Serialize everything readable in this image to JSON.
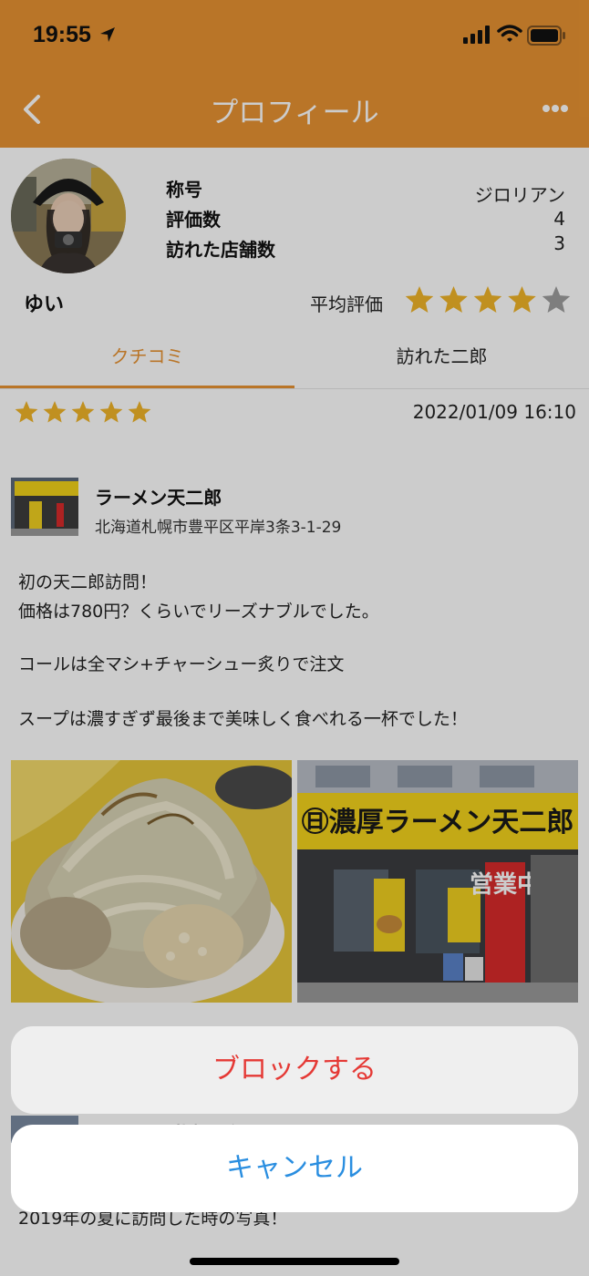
{
  "status_bar": {
    "time": "19:55"
  },
  "nav": {
    "title": "プロフィール",
    "back_icon": "chevron-left-icon",
    "more_icon": "ellipsis-icon"
  },
  "colors": {
    "accent": "#e89332",
    "destructive": "#e53935",
    "link": "#2a8ee0",
    "star": "#f0b429",
    "star_empty": "#9e9e9e"
  },
  "profile": {
    "username": "ゆい",
    "rows": [
      {
        "label": "称号",
        "value": "ジロリアン"
      },
      {
        "label": "評価数",
        "value": "4"
      },
      {
        "label": "訪れた店舗数",
        "value": "3"
      }
    ],
    "avg_label": "平均評価",
    "avg_rating": 4,
    "max_rating": 5
  },
  "tabs": [
    {
      "label": "クチコミ",
      "active": true
    },
    {
      "label": "訪れた二郎",
      "active": false
    }
  ],
  "review": {
    "rating": 5,
    "date": "2022/01/09 16:10",
    "shop_name": "ラーメン天二郎",
    "shop_address": "北海道札幌市豊平区平岸3条3-1-29",
    "lines": [
      "初の天二郎訪問！",
      "価格は780円？くらいでリーズナブルでした。",
      "コールは全マシ+チャーシュー炙りで注文",
      "スープは濃すぎず最後まで美味しく食べれる一杯でした！"
    ],
    "photo_sign": "㊐濃厚ラーメン天二郎",
    "banner_text": "営業中"
  },
  "next_review": {
    "shop_name": "ラーメン 札幌二郎",
    "text": "2019年の夏に訪問した時の写真！"
  },
  "action_sheet": {
    "block_label": "ブロックする",
    "cancel_label": "キャンセル"
  }
}
